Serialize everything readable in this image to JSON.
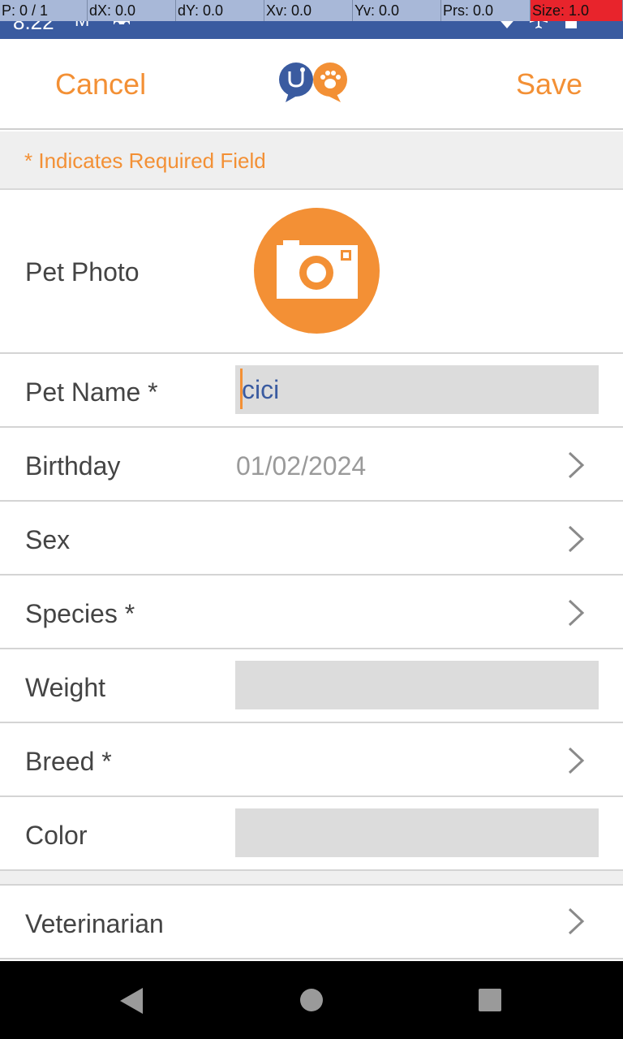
{
  "overlay": {
    "pointer": "P: 0 / 1",
    "dx": "dX: 0.0",
    "dy": "dY: 0.0",
    "xv": "Xv: 0.0",
    "yv": "Yv: 0.0",
    "prs": "Prs: 0.0",
    "size": "Size: 1.0"
  },
  "status_bar": {
    "time": "8:22"
  },
  "header": {
    "cancel_label": "Cancel",
    "save_label": "Save",
    "logo_icon": "vet-paw-logo-icon"
  },
  "required_hint": "* Indicates Required Field",
  "form": {
    "pet_photo_label": "Pet Photo",
    "pet_name_label": "Pet Name *",
    "pet_name_value": "cici",
    "birthday_label": "Birthday",
    "birthday_value": "01/02/2024",
    "sex_label": "Sex",
    "species_label": "Species *",
    "weight_label": "Weight",
    "breed_label": "Breed *",
    "color_label": "Color",
    "veterinarian_label": "Veterinarian"
  },
  "colors": {
    "accent": "#f39035",
    "brand_blue": "#3a5ba0",
    "field_bg": "#dcdcdc"
  }
}
